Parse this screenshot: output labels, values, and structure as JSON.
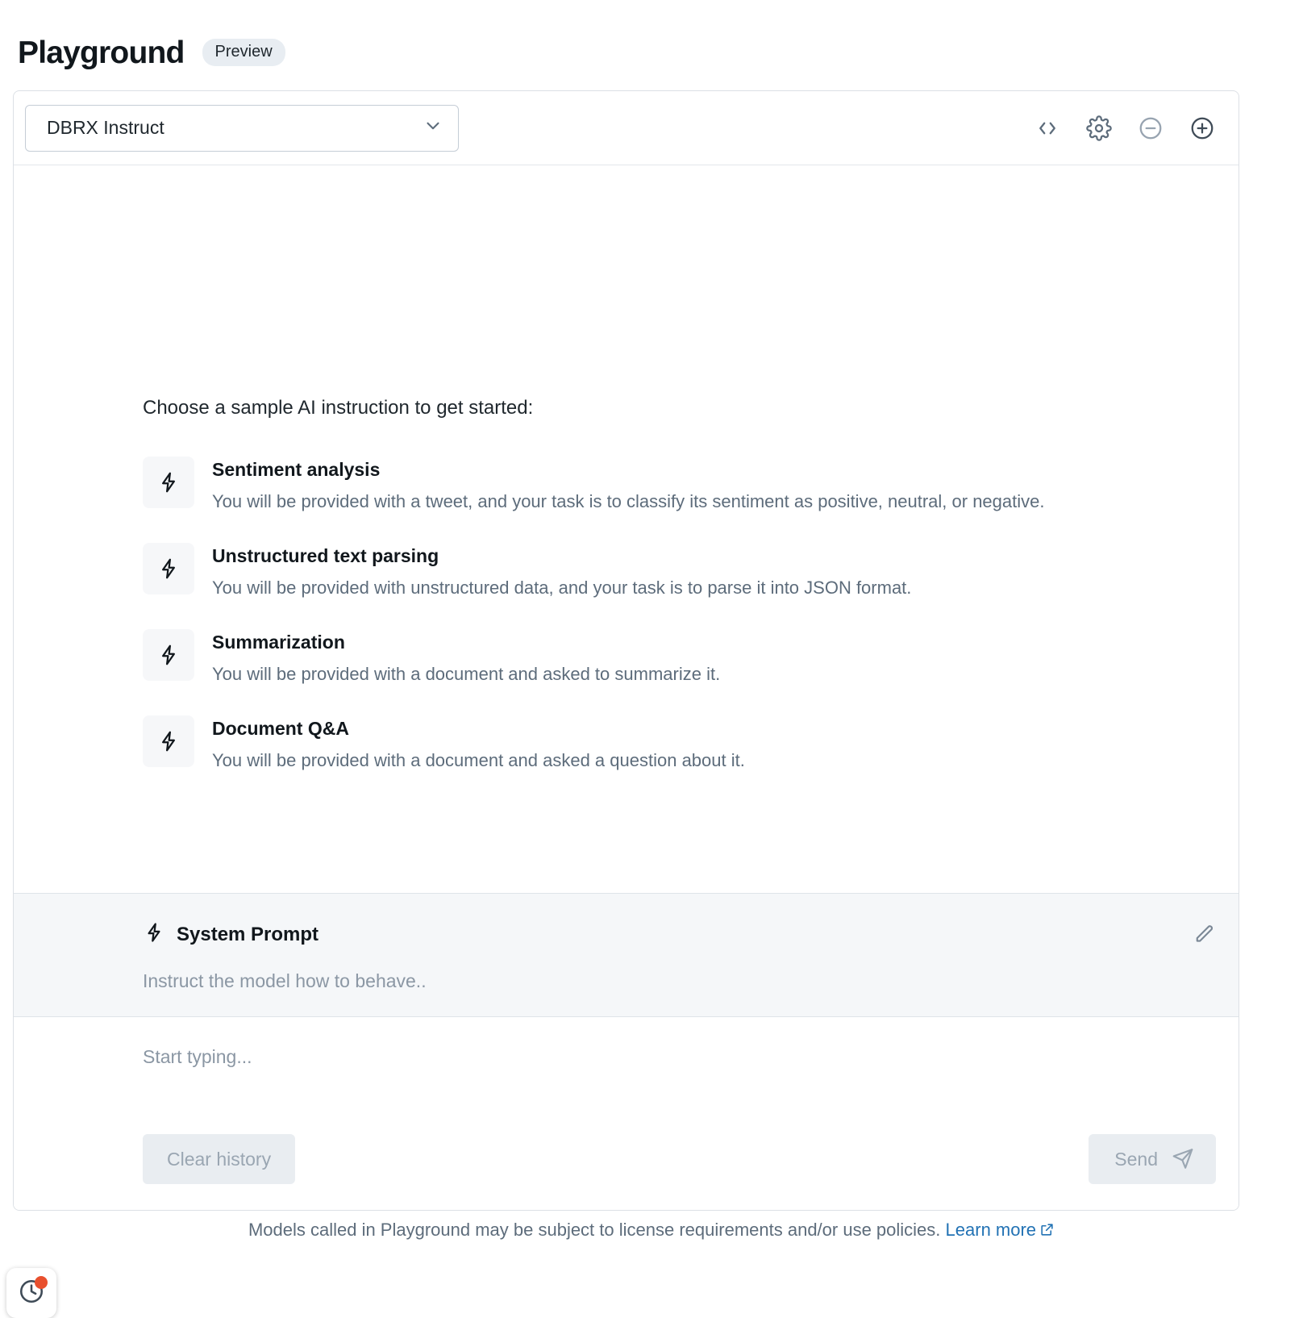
{
  "header": {
    "title": "Playground",
    "badge": "Preview"
  },
  "toolbar": {
    "model_selected": "DBRX Instruct",
    "chevron_icon": "chevron-down-icon",
    "actions": [
      {
        "name": "code-icon",
        "title": "View code"
      },
      {
        "name": "gear-icon",
        "title": "Settings"
      },
      {
        "name": "minus-circle-icon",
        "title": "Remove model"
      },
      {
        "name": "plus-circle-icon",
        "title": "Add model"
      }
    ]
  },
  "samples": {
    "heading": "Choose a sample AI instruction to get started:",
    "items": [
      {
        "icon": "lightning-icon",
        "title": "Sentiment analysis",
        "description": "You will be provided with a tweet, and your task is to classify its sentiment as positive, neutral, or negative."
      },
      {
        "icon": "lightning-icon",
        "title": "Unstructured text parsing",
        "description": "You will be provided with unstructured data, and your task is to parse it into JSON format."
      },
      {
        "icon": "lightning-icon",
        "title": "Summarization",
        "description": "You will be provided with a document and asked to summarize it."
      },
      {
        "icon": "lightning-icon",
        "title": "Document Q&A",
        "description": "You will be provided with a document and asked a question about it."
      }
    ]
  },
  "system_prompt": {
    "icon": "lightning-icon",
    "title": "System Prompt",
    "placeholder": "Instruct the model how to behave..",
    "edit_icon": "pencil-icon"
  },
  "composer": {
    "placeholder": "Start typing...",
    "clear_label": "Clear history",
    "send_label": "Send",
    "send_icon": "paper-plane-icon"
  },
  "footer": {
    "text": "Models called in Playground may be subject to license requirements and/or use policies.",
    "link_label": "Learn more",
    "link_icon": "external-link-icon"
  },
  "history_widget": {
    "icon": "clock-history-icon",
    "badge_color": "#e8502e"
  },
  "colors": {
    "accent_link": "#2272b4",
    "badge_bg": "#e8edf2",
    "muted_text": "#5d6c7b",
    "panel_bg": "#f5f7f9"
  }
}
